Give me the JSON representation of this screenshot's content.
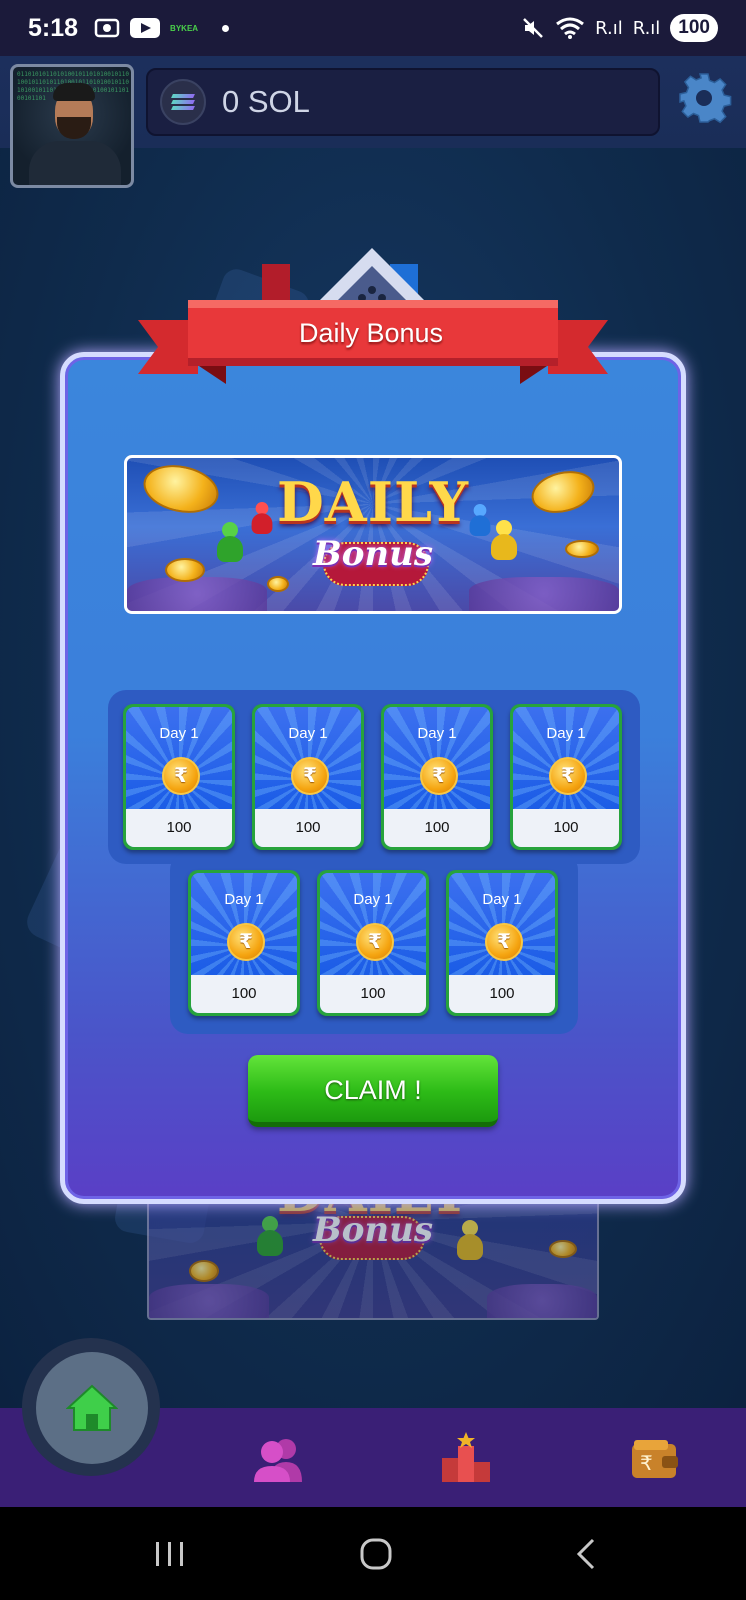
{
  "status_bar": {
    "time": "5:18",
    "app_badge": "BYKEA",
    "signal_1": "R.ıl",
    "signal_2": "R.ıl",
    "battery": "100"
  },
  "header": {
    "balance": "0 SOL",
    "currency_icon": "solana-icon",
    "settings_icon": "gear-icon",
    "avatar_code": "01101010110101001011010100101101001011010110100101101010010110101001011010100101101010010110100101101"
  },
  "modal": {
    "title": "Daily Bonus",
    "banner_title": "DAILY",
    "banner_subtitle": "Bonus",
    "rewards": [
      {
        "day": "Day 1",
        "amount": "100",
        "coin_symbol": "₹"
      },
      {
        "day": "Day 1",
        "amount": "100",
        "coin_symbol": "₹"
      },
      {
        "day": "Day 1",
        "amount": "100",
        "coin_symbol": "₹"
      },
      {
        "day": "Day 1",
        "amount": "100",
        "coin_symbol": "₹"
      },
      {
        "day": "Day 1",
        "amount": "100",
        "coin_symbol": "₹"
      },
      {
        "day": "Day 1",
        "amount": "100",
        "coin_symbol": "₹"
      },
      {
        "day": "Day 1",
        "amount": "100",
        "coin_symbol": "₹"
      }
    ],
    "claim_label": "CLAIM !"
  },
  "background": {
    "banner_title": "DAILY",
    "banner_subtitle": "Bonus"
  },
  "bottom_nav": {
    "items": [
      {
        "name": "home",
        "icon": "home-icon",
        "active": true
      },
      {
        "name": "friends",
        "icon": "users-icon",
        "active": false
      },
      {
        "name": "leaderboard",
        "icon": "podium-icon",
        "active": false
      },
      {
        "name": "wallet",
        "icon": "wallet-icon",
        "active": false
      }
    ]
  },
  "colors": {
    "modal_border": "#d6dcff",
    "ribbon": "#e8383a",
    "claim_green": "#2dbb17",
    "card_border": "#27a33c",
    "nav_bg": "#3a1f76"
  }
}
